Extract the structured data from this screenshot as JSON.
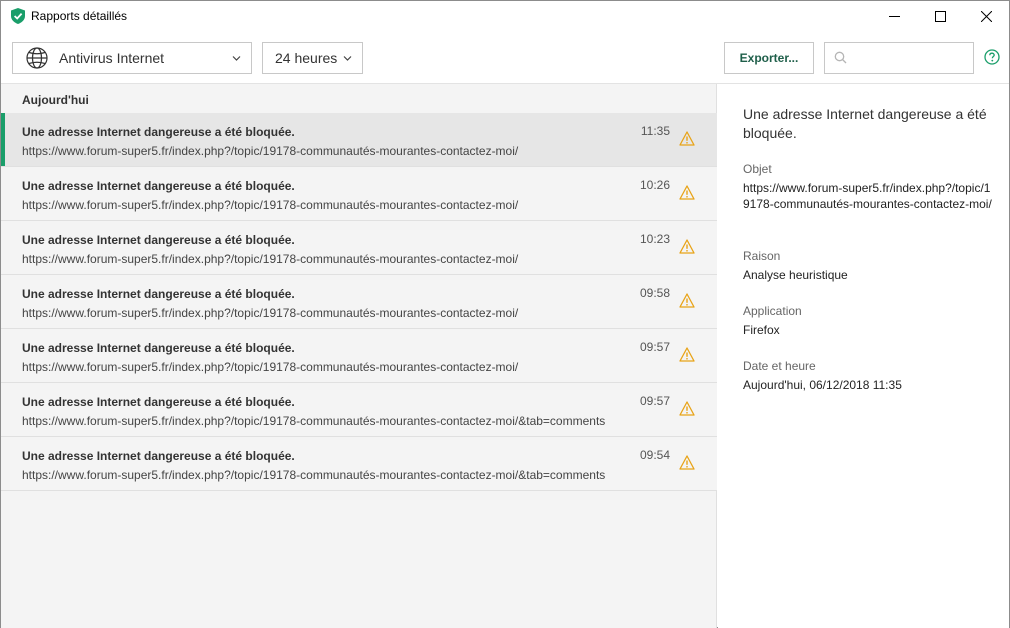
{
  "window": {
    "title": "Rapports détaillés",
    "accent_color": "#1a9e6a"
  },
  "toolbar": {
    "component_dropdown": {
      "label": "Antivirus Internet",
      "icon": "globe-icon"
    },
    "period_dropdown": {
      "label": "24 heures"
    },
    "export_label": "Exporter...",
    "search": {
      "value": "",
      "placeholder": ""
    }
  },
  "list": {
    "group_header": "Aujourd'hui",
    "rows": [
      {
        "title": "Une adresse Internet dangereuse a été bloquée.",
        "url": "https://www.forum-super5.fr/index.php?/topic/19178-communautés-mourantes-contactez-moi/",
        "time": "11:35",
        "icon": "warning-icon",
        "selected": true
      },
      {
        "title": "Une adresse Internet dangereuse a été bloquée.",
        "url": "https://www.forum-super5.fr/index.php?/topic/19178-communautés-mourantes-contactez-moi/",
        "time": "10:26",
        "icon": "warning-icon",
        "selected": false
      },
      {
        "title": "Une adresse Internet dangereuse a été bloquée.",
        "url": "https://www.forum-super5.fr/index.php?/topic/19178-communautés-mourantes-contactez-moi/",
        "time": "10:23",
        "icon": "warning-icon",
        "selected": false
      },
      {
        "title": "Une adresse Internet dangereuse a été bloquée.",
        "url": "https://www.forum-super5.fr/index.php?/topic/19178-communautés-mourantes-contactez-moi/",
        "time": "09:58",
        "icon": "warning-icon",
        "selected": false
      },
      {
        "title": "Une adresse Internet dangereuse a été bloquée.",
        "url": "https://www.forum-super5.fr/index.php?/topic/19178-communautés-mourantes-contactez-moi/",
        "time": "09:57",
        "icon": "warning-icon",
        "selected": false
      },
      {
        "title": "Une adresse Internet dangereuse a été bloquée.",
        "url": "https://www.forum-super5.fr/index.php?/topic/19178-communautés-mourantes-contactez-moi/&tab=comments",
        "time": "09:57",
        "icon": "warning-icon",
        "selected": false
      },
      {
        "title": "Une adresse Internet dangereuse a été bloquée.",
        "url": "https://www.forum-super5.fr/index.php?/topic/19178-communautés-mourantes-contactez-moi/&tab=comments",
        "time": "09:54",
        "icon": "warning-icon",
        "selected": false
      }
    ]
  },
  "detail": {
    "title": "Une adresse Internet dangereuse a été bloquée.",
    "object_label": "Objet",
    "object_value": "https://www.forum-super5.fr/index.php?/topic/19178-communautés-mourantes-contactez-moi/",
    "reason_label": "Raison",
    "reason_value": "Analyse heuristique",
    "application_label": "Application",
    "application_value": "Firefox",
    "datetime_label": "Date et heure",
    "datetime_value": "Aujourd'hui, 06/12/2018 11:35"
  }
}
